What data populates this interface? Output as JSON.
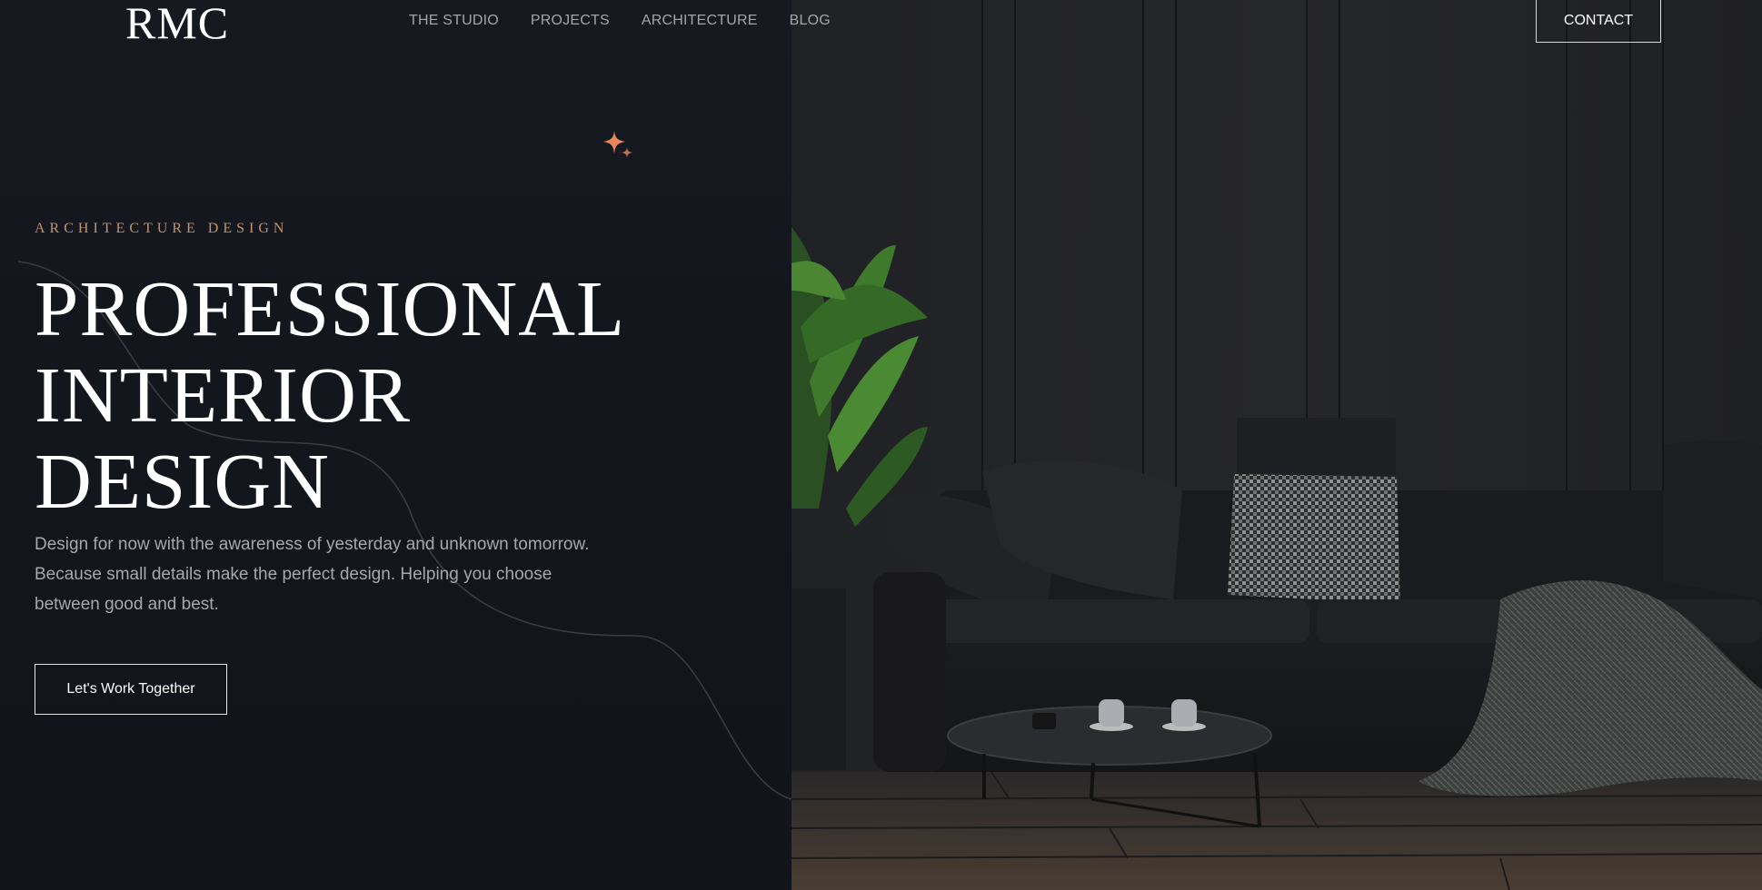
{
  "brand": {
    "logo": "RMC"
  },
  "nav": {
    "items": [
      {
        "label": "THE STUDIO"
      },
      {
        "label": "PROJECTS"
      },
      {
        "label": "ARCHITECTURE"
      },
      {
        "label": "BLOG"
      }
    ],
    "contact_label": "CONTACT"
  },
  "hero": {
    "eyebrow": "ARCHITECTURE DESIGN",
    "title_lines": [
      "PROFESSIONAL",
      "INTERIOR",
      "DESIGN"
    ],
    "description_lines": [
      "Design for now with the awareness of yesterday and unknown tomorrow.",
      "Because small details make the perfect design. Helping you choose",
      "between good and best."
    ],
    "cta_label": "Let's Work Together",
    "image_icon": "interior-photo"
  },
  "colors": {
    "background": "#12141b",
    "accent_gold": "#c2946b",
    "sparkle": "#e8875a",
    "text_primary": "#ffffff",
    "text_muted": "#a6a8ae"
  },
  "icons": {
    "sparkle": "sparkle-icon"
  }
}
